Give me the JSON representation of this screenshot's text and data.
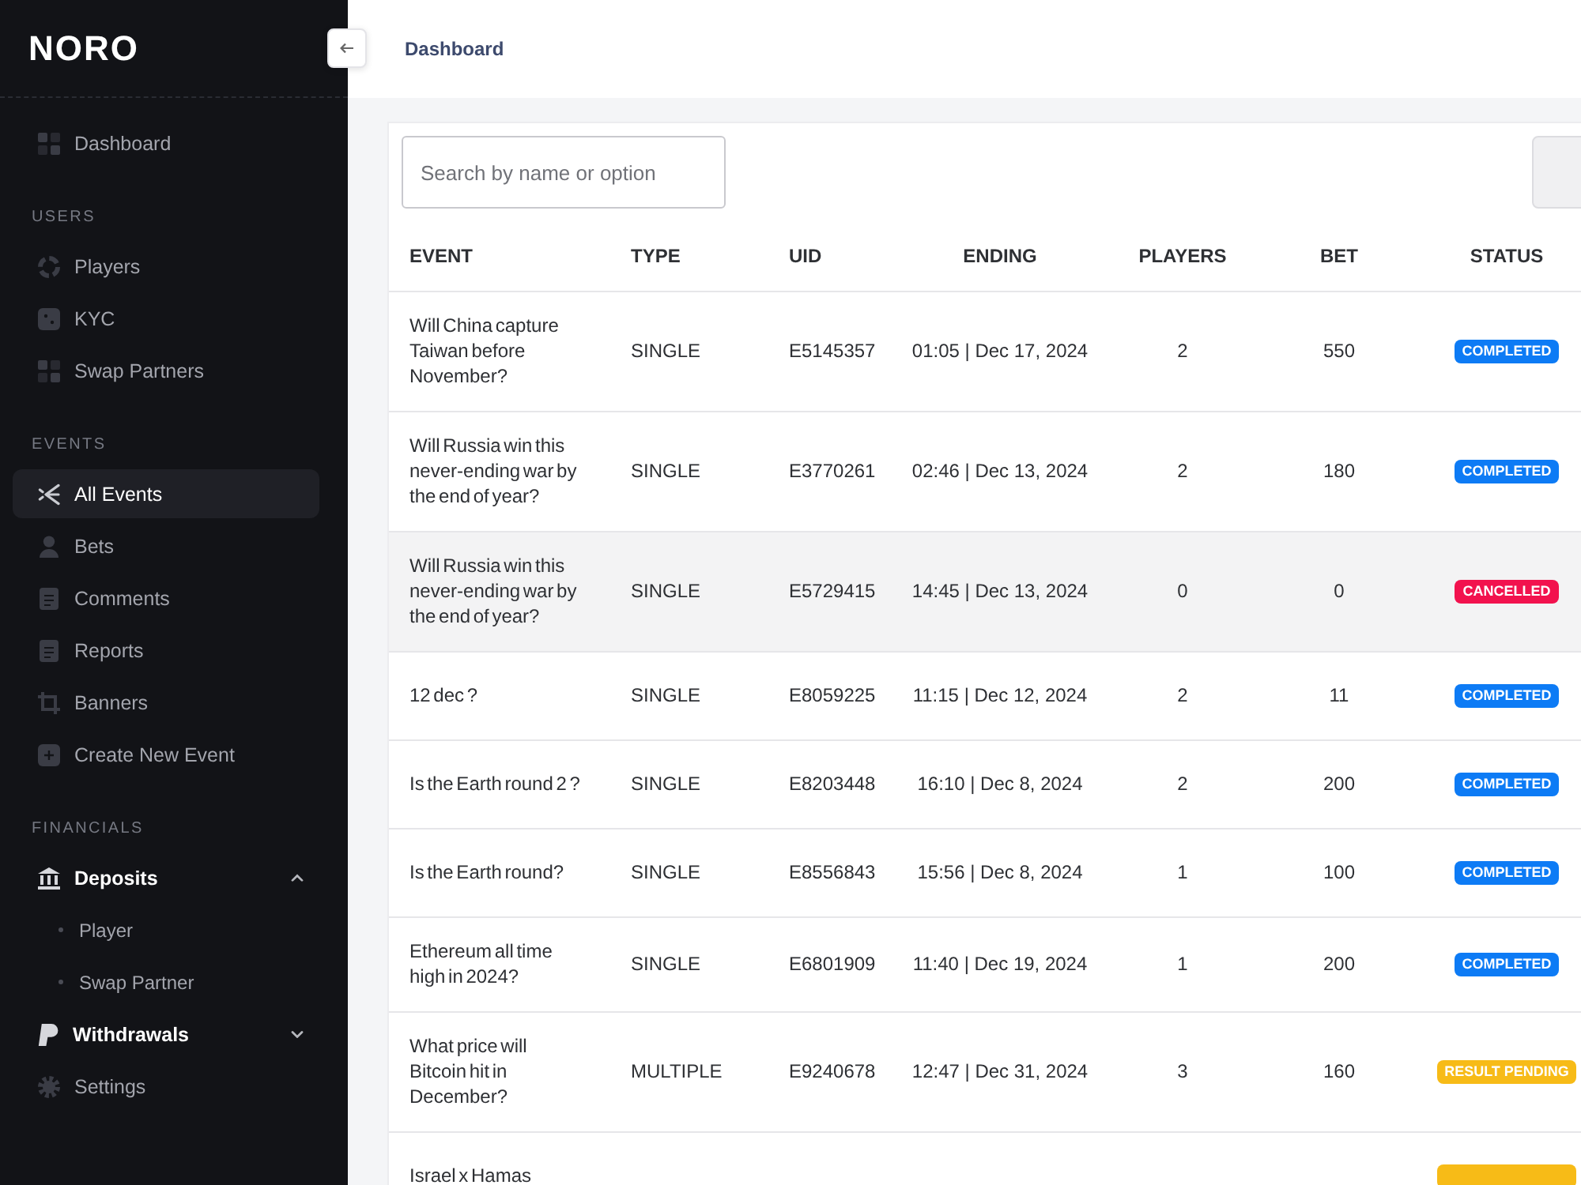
{
  "sidebar": {
    "logo": "NORO",
    "sections": [
      {
        "items": [
          {
            "kind": "link",
            "label": "Dashboard",
            "selected": false
          }
        ]
      },
      {
        "title": "USERS",
        "items": [
          {
            "kind": "link",
            "label": "Players",
            "selected": false
          },
          {
            "kind": "link",
            "label": "KYC",
            "selected": false
          },
          {
            "kind": "link",
            "label": "Swap Partners",
            "selected": false
          }
        ]
      },
      {
        "title": "EVENTS",
        "items": [
          {
            "kind": "link",
            "label": "All Events",
            "selected": true
          },
          {
            "kind": "link",
            "label": "Bets",
            "selected": false
          },
          {
            "kind": "link",
            "label": "Comments",
            "selected": false
          },
          {
            "kind": "link",
            "label": "Reports",
            "selected": false
          },
          {
            "kind": "link",
            "label": "Banners",
            "selected": false
          },
          {
            "kind": "link",
            "label": "Create New Event",
            "selected": false
          }
        ]
      },
      {
        "title": "FINANCIALS",
        "items": [
          {
            "kind": "group",
            "label": "Deposits",
            "selected": false,
            "expanded": true,
            "children": [
              {
                "label": "Player",
                "selected": false
              },
              {
                "label": "Swap Partner",
                "selected": false
              }
            ]
          },
          {
            "kind": "group",
            "label": "Withdrawals",
            "selected": false,
            "expanded": false
          },
          {
            "kind": "link",
            "label": "Settings",
            "selected": false
          }
        ]
      }
    ]
  },
  "header": {
    "breadcrumb": "Dashboard"
  },
  "events": {
    "search": {
      "placeholder": "Search by name or option"
    },
    "table": {
      "columns": [
        "EVENT",
        "TYPE",
        "UID",
        "ENDING",
        "PLAYERS",
        "BET",
        "STATUS"
      ],
      "rows": [
        {
          "event": "Will China capture Taiwan before November?",
          "type": "SINGLE",
          "uid": "E5145357",
          "ending": "01:05 | Dec 17, 2024",
          "players": "2",
          "bet": "550",
          "status": {
            "label": "COMPLETED",
            "color": "#0d7bf5"
          },
          "hovered": false
        },
        {
          "event": "Will Russia win this never-ending war by the end of year?",
          "type": "SINGLE",
          "uid": "E3770261",
          "ending": "02:46 | Dec 13, 2024",
          "players": "2",
          "bet": "180",
          "status": {
            "label": "COMPLETED",
            "color": "#0d7bf5"
          },
          "hovered": false
        },
        {
          "event": "Will Russia win this never-ending war by the end of year?",
          "type": "SINGLE",
          "uid": "E5729415",
          "ending": "14:45 | Dec 13, 2024",
          "players": "0",
          "bet": "0",
          "status": {
            "label": "CANCELLED",
            "color": "#f2124e"
          },
          "hovered": true
        },
        {
          "event": "12 dec ?",
          "type": "SINGLE",
          "uid": "E8059225",
          "ending": "11:15 | Dec 12, 2024",
          "players": "2",
          "bet": "11",
          "status": {
            "label": "COMPLETED",
            "color": "#0d7bf5"
          },
          "hovered": false
        },
        {
          "event": "Is the Earth round 2 ?",
          "type": "SINGLE",
          "uid": "E8203448",
          "ending": "16:10 | Dec 8, 2024",
          "players": "2",
          "bet": "200",
          "status": {
            "label": "COMPLETED",
            "color": "#0d7bf5"
          },
          "hovered": false
        },
        {
          "event": "Is the Earth round?",
          "type": "SINGLE",
          "uid": "E8556843",
          "ending": "15:56 | Dec 8, 2024",
          "players": "1",
          "bet": "100",
          "status": {
            "label": "COMPLETED",
            "color": "#0d7bf5"
          },
          "hovered": false
        },
        {
          "event": "Ethereum all time high in 2024?",
          "type": "SINGLE",
          "uid": "E6801909",
          "ending": "11:40 | Dec 19, 2024",
          "players": "1",
          "bet": "200",
          "status": {
            "label": "COMPLETED",
            "color": "#0d7bf5"
          },
          "hovered": false
        },
        {
          "event": "What price will Bitcoin hit in December?",
          "type": "MULTIPLE",
          "uid": "E9240678",
          "ending": "12:47 | Dec 31, 2024",
          "players": "3",
          "bet": "160",
          "status": {
            "label": "RESULT PENDING",
            "color": "#f7bb17"
          },
          "hovered": false
        },
        {
          "event": "Israel x Hamas",
          "status": {
            "color": "#f7bb17"
          },
          "hovered": false
        }
      ]
    }
  }
}
